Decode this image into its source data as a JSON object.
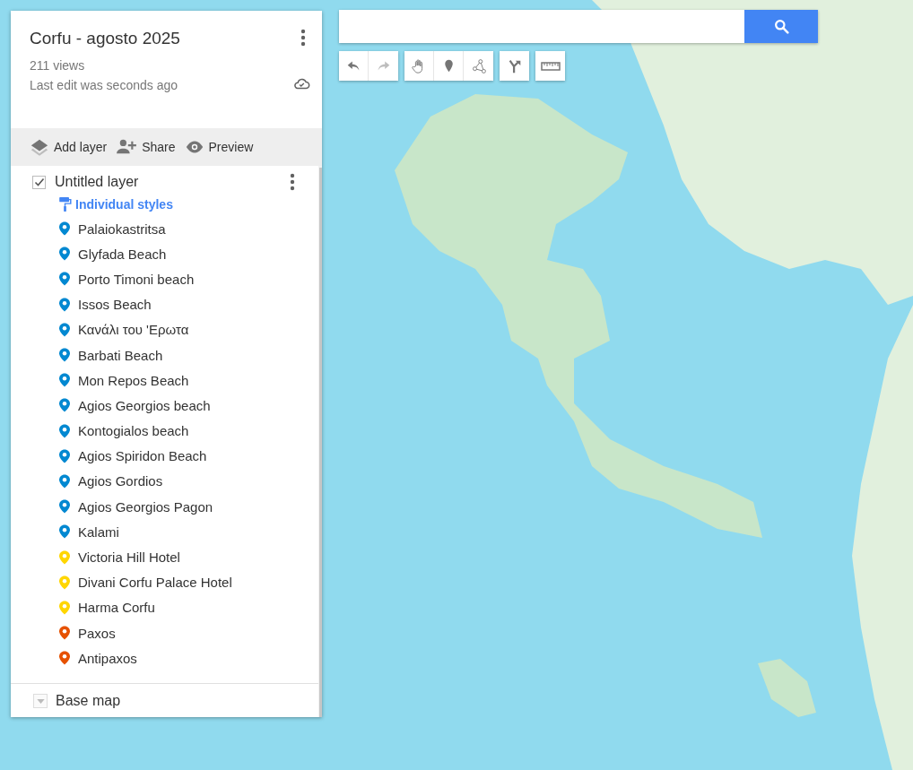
{
  "map": {
    "title": "Corfu - agosto 2025",
    "views": "211 views",
    "last_edit": "Last edit was seconds ago"
  },
  "actions": [
    "Add layer",
    "Share",
    "Preview"
  ],
  "layer": {
    "name": "Untitled layer",
    "checked": true,
    "style": "Individual styles",
    "places": [
      {
        "name": "Palaiokastritsa",
        "color": "#0288d1"
      },
      {
        "name": "Glyfada Beach",
        "color": "#0288d1"
      },
      {
        "name": "Porto Timoni beach",
        "color": "#0288d1"
      },
      {
        "name": "Issos Beach",
        "color": "#0288d1"
      },
      {
        "name": "Κανάλι του 'Ερωτα",
        "color": "#0288d1"
      },
      {
        "name": "Barbati Beach",
        "color": "#0288d1"
      },
      {
        "name": "Mon Repos Beach",
        "color": "#0288d1"
      },
      {
        "name": "Agios Georgios beach",
        "color": "#0288d1"
      },
      {
        "name": "Kontogialos beach",
        "color": "#0288d1"
      },
      {
        "name": "Agios Spiridon Beach",
        "color": "#0288d1"
      },
      {
        "name": "Agios Gordios",
        "color": "#0288d1"
      },
      {
        "name": "Agios Georgios Pagon",
        "color": "#0288d1"
      },
      {
        "name": "Kalami",
        "color": "#0288d1"
      },
      {
        "name": "Victoria Hill Hotel",
        "color": "#ffd600"
      },
      {
        "name": "Divani Corfu Palace Hotel",
        "color": "#ffd600"
      },
      {
        "name": "Harma Corfu",
        "color": "#ffd600"
      },
      {
        "name": "Paxos",
        "color": "#e65100"
      },
      {
        "name": "Antipaxos",
        "color": "#e65100"
      }
    ]
  },
  "base_map": {
    "label": "Base map"
  }
}
